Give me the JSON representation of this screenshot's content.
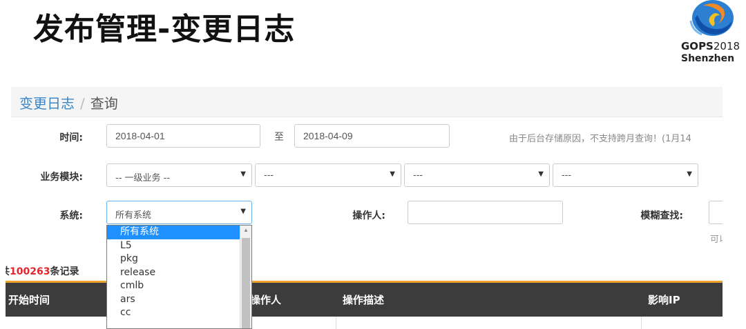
{
  "slide": {
    "title": "发布管理-变更日志"
  },
  "logo": {
    "brand": "GOPS",
    "year": "2018",
    "city": "Shenzhen"
  },
  "breadcrumb": {
    "link": "变更日志",
    "separator": "/",
    "current": "查询"
  },
  "form": {
    "time_label": "时间:",
    "start_date": "2018-04-01",
    "to_label": "至",
    "end_date": "2018-04-09",
    "note": "由于后台存储原因，不支持跨月查询！(1月14",
    "business_label": "业务模块:",
    "business_selects": [
      "-- 一级业务 --",
      "---",
      "---",
      "---"
    ],
    "system_label": "系统:",
    "system_value": "所有系统",
    "operator_label": "操作人:",
    "operator_value": "",
    "fuzzy_label": "模糊查找:",
    "fuzzy_hint": "可以"
  },
  "system_dropdown": {
    "options": [
      "所有系统",
      "L5",
      "pkg",
      "release",
      "cmlb",
      "ars",
      "cc"
    ],
    "selected_index": 0
  },
  "records": {
    "prefix": "共",
    "count": "100263",
    "suffix": "条记录"
  },
  "table": {
    "columns": [
      "开始时间",
      "操作人",
      "操作描述",
      "影响IP"
    ],
    "header_accent": "#f0a32a",
    "header_bg": "#3c3c3c"
  }
}
